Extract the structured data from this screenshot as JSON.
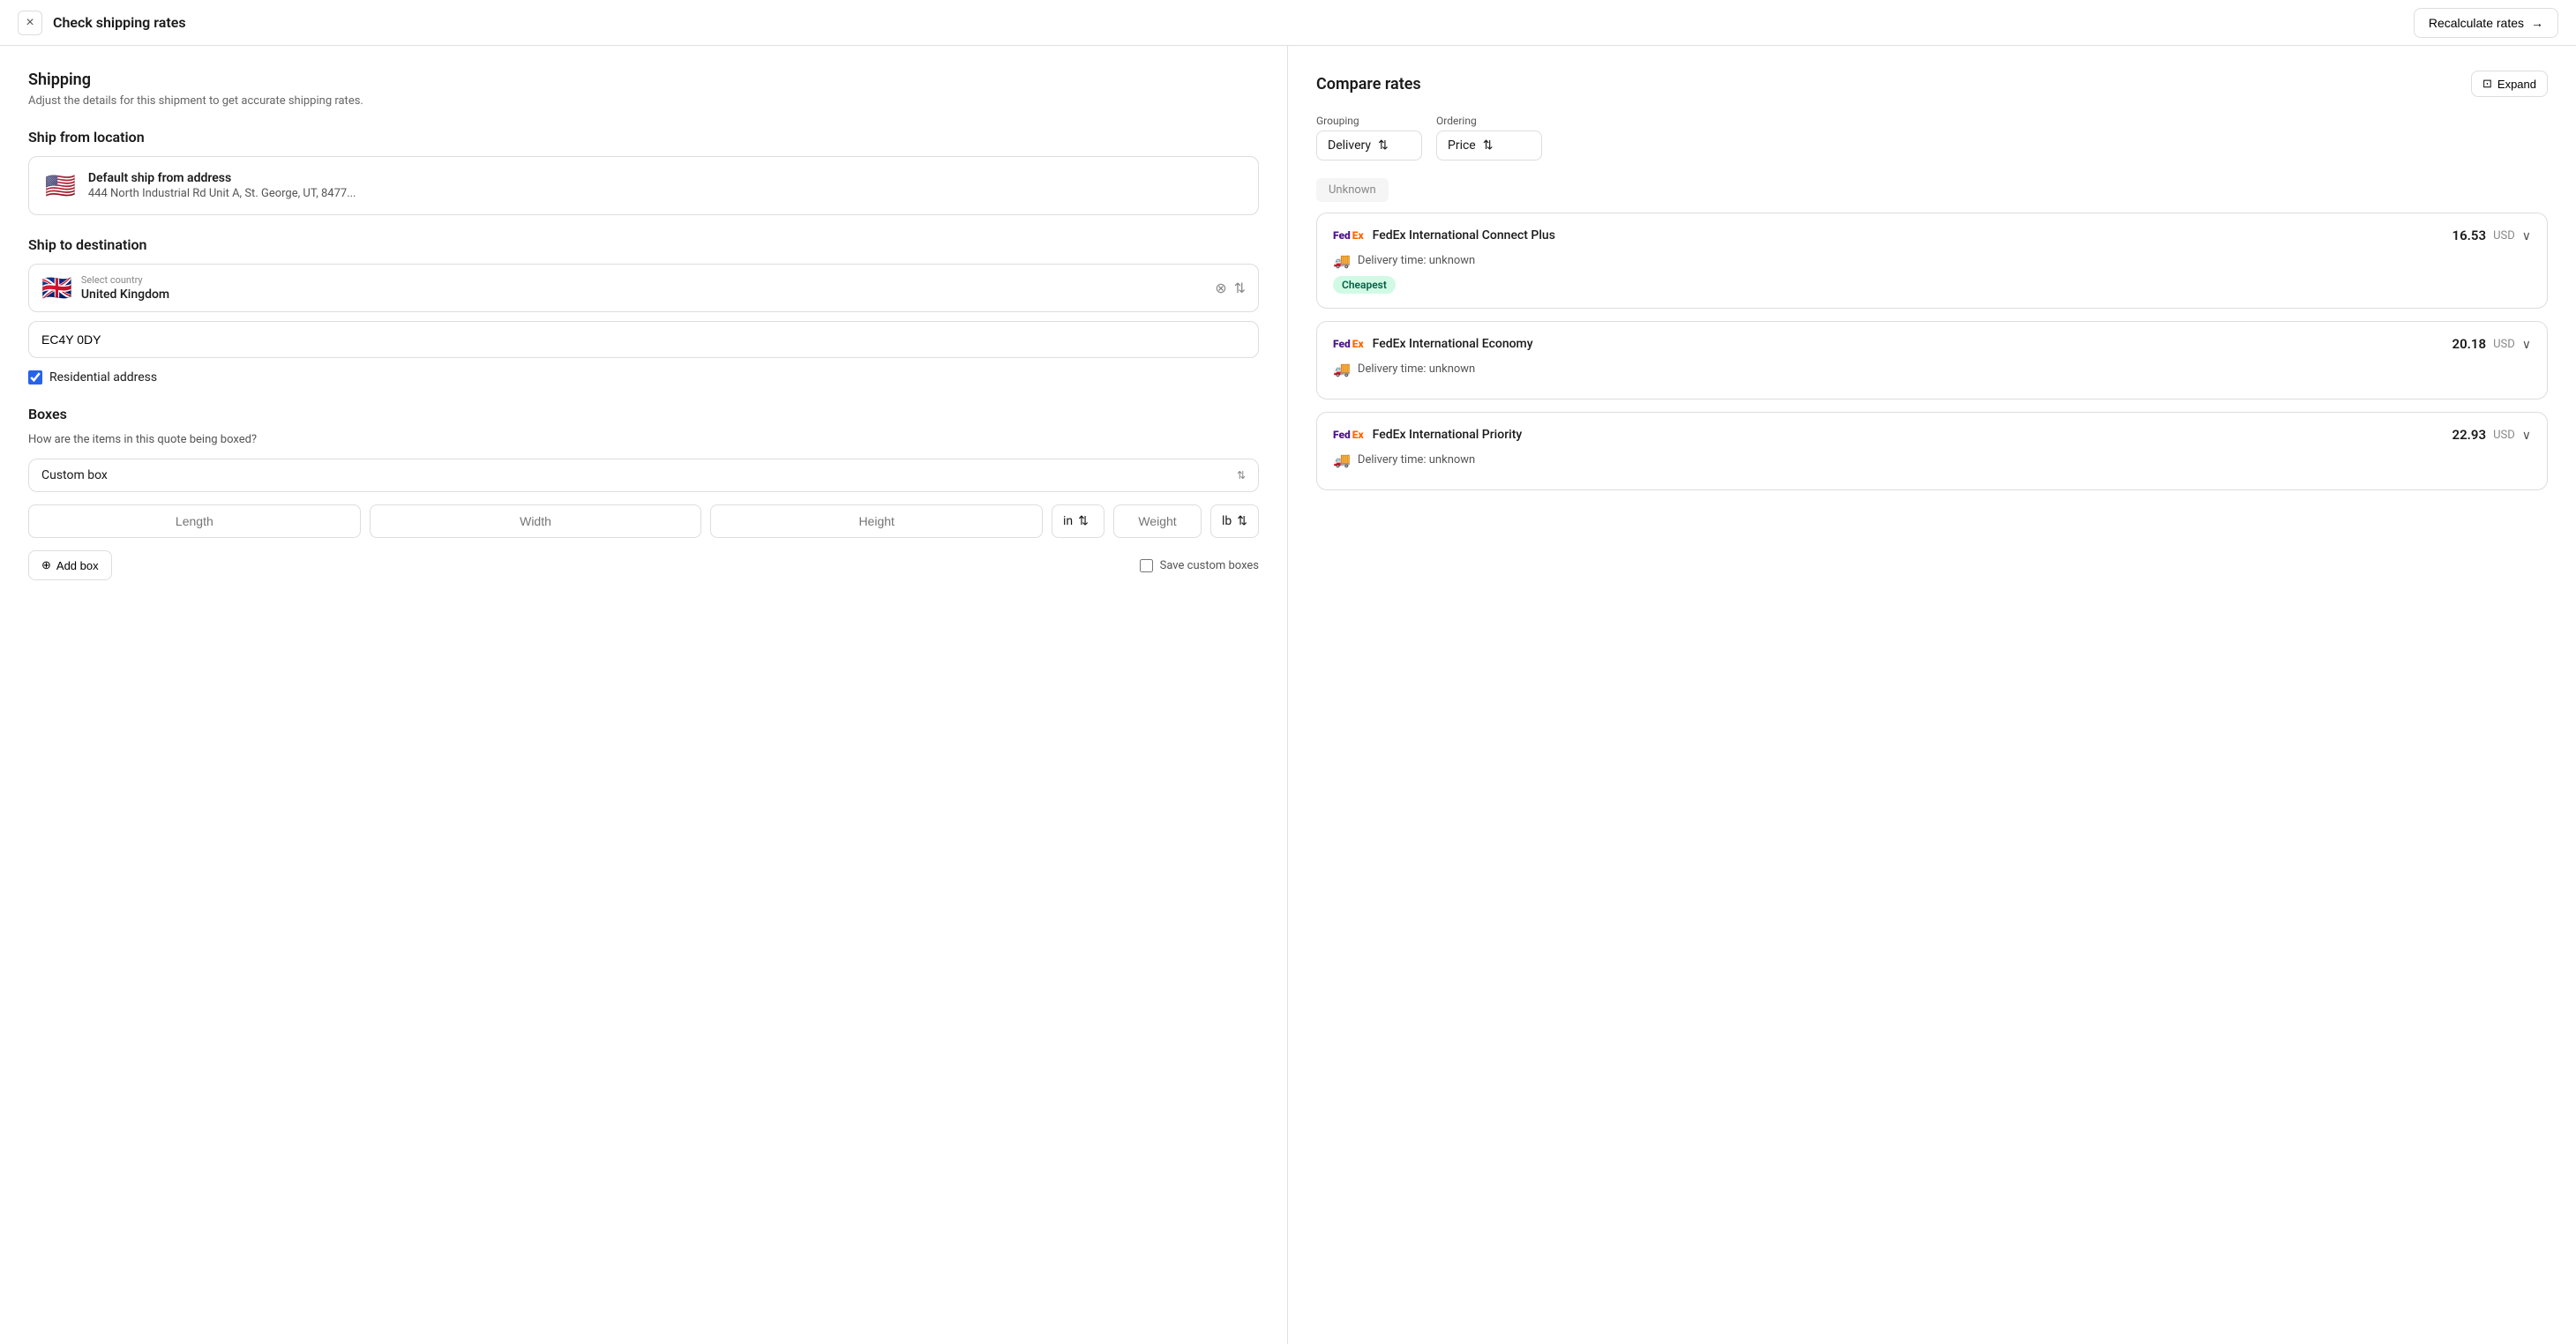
{
  "header": {
    "title": "Check shipping rates",
    "recalculate_label": "Recalculate rates",
    "close_icon": "×"
  },
  "left": {
    "shipping_title": "Shipping",
    "shipping_subtitle": "Adjust the details for this shipment to get accurate shipping rates.",
    "ship_from_title": "Ship from location",
    "ship_from": {
      "name": "Default ship from address",
      "address": "444 North Industrial Rd Unit A, St. George, UT, 8477..."
    },
    "ship_to_title": "Ship to destination",
    "country_label": "Select country",
    "country_value": "United Kingdom",
    "postal_value": "EC4Y 0DY",
    "postal_placeholder": "EC4Y 0DY",
    "residential_label": "Residential address",
    "residential_checked": true,
    "boxes_title": "Boxes",
    "boxes_question": "How are the items in this quote being boxed?",
    "box_type": "Custom box",
    "length_placeholder": "Length",
    "width_placeholder": "Width",
    "height_placeholder": "Height",
    "unit_label": "in",
    "weight_placeholder": "Weight",
    "weight_unit": "lb",
    "add_box_label": "Add box",
    "save_custom_label": "Save custom boxes"
  },
  "right": {
    "compare_title": "Compare rates",
    "expand_label": "Expand",
    "grouping_label": "Grouping",
    "grouping_value": "Delivery",
    "ordering_label": "Ordering",
    "ordering_value": "Price",
    "group_name": "Unknown",
    "rates": [
      {
        "name": "FedEx International Connect Plus",
        "price": "16.53",
        "currency": "USD",
        "delivery": "Delivery time: unknown",
        "badge": "Cheapest"
      },
      {
        "name": "FedEx International Economy",
        "price": "20.18",
        "currency": "USD",
        "delivery": "Delivery time: unknown",
        "badge": ""
      },
      {
        "name": "FedEx International Priority",
        "price": "22.93",
        "currency": "USD",
        "delivery": "Delivery time: unknown",
        "badge": ""
      }
    ]
  }
}
